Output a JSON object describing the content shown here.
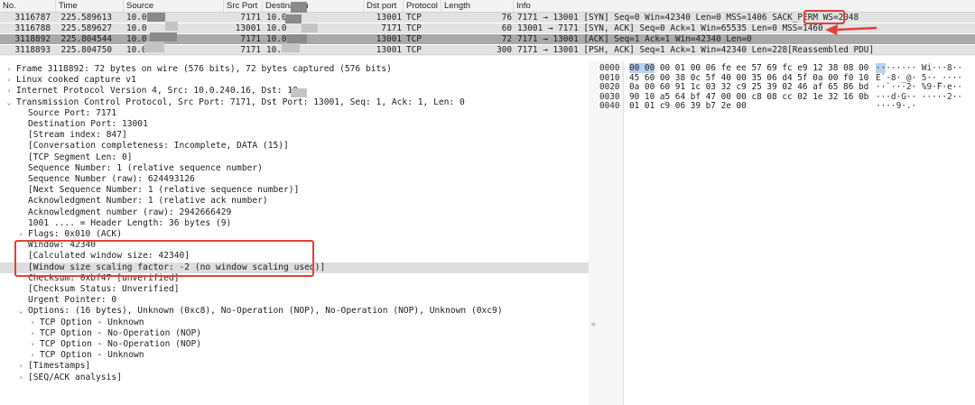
{
  "columns": {
    "no": "No.",
    "time": "Time",
    "source": "Source",
    "src_port": "Src Port",
    "destination": "Destination",
    "dst_port": "Dst port",
    "protocol": "Protocol",
    "length": "Length",
    "info": "Info"
  },
  "packets": [
    {
      "no": "3116787",
      "time": "225.589613",
      "source": "10.0",
      "src_port": "7171",
      "destination": "10.0",
      "dst_port": "13001",
      "protocol": "TCP",
      "length": "76",
      "info": "7171 → 13001 [SYN] Seq=0 Win=42340 Len=0 MSS=1406 SACK_PERM ",
      "info_highlight": "WS=2048"
    },
    {
      "no": "3116788",
      "time": "225.589627",
      "source": "10.0",
      "src_port": "13001",
      "destination": "10.0",
      "dst_port": "7171",
      "protocol": "TCP",
      "length": "60",
      "info": "13001 → 7171 [SYN, ACK] Seq=0 Ack=1 Win=65535 Len=0 MSS=1460",
      "info_highlight": ""
    },
    {
      "no": "3118892",
      "time": "225.804544",
      "source": "10.0",
      "src_port": "7171",
      "destination": "10.0",
      "dst_port": "13001",
      "protocol": "TCP",
      "length": "72",
      "info": "7171 → 13001 [ACK] Seq=1 Ack=1 Win=42340 Len=0",
      "info_highlight": ""
    },
    {
      "no": "3118893",
      "time": "225.804750",
      "source": "10.0",
      "src_port": "7171",
      "destination": "10.0",
      "dst_port": "13001",
      "protocol": "TCP",
      "length": "300",
      "info": "7171 → 13001 [PSH, ACK] Seq=1 Ack=1 Win=42340 Len=228[Reassembled PDU]",
      "info_highlight": ""
    }
  ],
  "tree": [
    {
      "indent": 0,
      "arrow": "right",
      "text": "Frame 3118892: 72 bytes on wire (576 bits), 72 bytes captured (576 bits)"
    },
    {
      "indent": 0,
      "arrow": "right",
      "text": "Linux cooked capture v1"
    },
    {
      "indent": 0,
      "arrow": "right",
      "text": "Internet Protocol Version 4, Src: 10.0.240.16, Dst: 10."
    },
    {
      "indent": 0,
      "arrow": "down",
      "text": "Transmission Control Protocol, Src Port: 7171, Dst Port: 13001, Seq: 1, Ack: 1, Len: 0"
    },
    {
      "indent": 1,
      "arrow": "",
      "text": "Source Port: 7171"
    },
    {
      "indent": 1,
      "arrow": "",
      "text": "Destination Port: 13001"
    },
    {
      "indent": 1,
      "arrow": "",
      "text": "[Stream index: 847]"
    },
    {
      "indent": 1,
      "arrow": "",
      "text": "[Conversation completeness: Incomplete, DATA (15)]"
    },
    {
      "indent": 1,
      "arrow": "",
      "text": "[TCP Segment Len: 0]"
    },
    {
      "indent": 1,
      "arrow": "",
      "text": "Sequence Number: 1    (relative sequence number)"
    },
    {
      "indent": 1,
      "arrow": "",
      "text": "Sequence Number (raw): 624493126"
    },
    {
      "indent": 1,
      "arrow": "",
      "text": "[Next Sequence Number: 1    (relative sequence number)]"
    },
    {
      "indent": 1,
      "arrow": "",
      "text": "Acknowledgment Number: 1    (relative ack number)"
    },
    {
      "indent": 1,
      "arrow": "",
      "text": "Acknowledgment number (raw): 2942666429"
    },
    {
      "indent": 1,
      "arrow": "",
      "text": "1001 .... = Header Length: 36 bytes (9)"
    },
    {
      "indent": 1,
      "arrow": "right",
      "text": "Flags: 0x010 (ACK)"
    },
    {
      "indent": 1,
      "arrow": "",
      "text": "Window: 42340"
    },
    {
      "indent": 1,
      "arrow": "",
      "text": "[Calculated window size: 42340]"
    },
    {
      "indent": 1,
      "arrow": "",
      "text": "[Window size scaling factor: -2 (no window scaling used)]"
    },
    {
      "indent": 1,
      "arrow": "",
      "text": "Checksum: 0xbf47 [unverified]"
    },
    {
      "indent": 1,
      "arrow": "",
      "text": "[Checksum Status: Unverified]"
    },
    {
      "indent": 1,
      "arrow": "",
      "text": "Urgent Pointer: 0"
    },
    {
      "indent": 1,
      "arrow": "down",
      "text": "Options: (16 bytes), Unknown (0xc8), No-Operation (NOP), No-Operation (NOP), Unknown (0xc9)"
    },
    {
      "indent": 2,
      "arrow": "right",
      "text": "TCP Option - Unknown"
    },
    {
      "indent": 2,
      "arrow": "right",
      "text": "TCP Option - No-Operation (NOP)"
    },
    {
      "indent": 2,
      "arrow": "right",
      "text": "TCP Option - No-Operation (NOP)"
    },
    {
      "indent": 2,
      "arrow": "right",
      "text": "TCP Option - Unknown"
    },
    {
      "indent": 1,
      "arrow": "right",
      "text": "[Timestamps]"
    },
    {
      "indent": 1,
      "arrow": "right",
      "text": "[SEQ/ACK analysis]"
    }
  ],
  "bytes": [
    {
      "offset": "0000",
      "hex_hl": "00 00",
      "hex": " 00 01 00 06 fe ee  57 69 fc e9 12 38 08 00",
      "ascii_hl": "··",
      "ascii": "······ Wi···8··"
    },
    {
      "offset": "0010",
      "hex_hl": "",
      "hex": "45 60 00 38 0c 5f 40 00  35 06 d4 5f 0a 00 f0 10",
      "ascii_hl": "",
      "ascii": "E`·8·_@· 5··_····"
    },
    {
      "offset": "0020",
      "hex_hl": "",
      "hex": "0a 00 60 91 1c 03 32 c9  25 39 02 46 af 65 86 bd",
      "ascii_hl": "",
      "ascii": "··`···2· %9·F·e··"
    },
    {
      "offset": "0030",
      "hex_hl": "",
      "hex": "90 10 a5 64 bf 47 00 00  c8 08 cc 02 1e 32 16 0b",
      "ascii_hl": "",
      "ascii": "···d·G·· ·····2··"
    },
    {
      "offset": "0040",
      "hex_hl": "",
      "hex": "01 01 c9 06 39 b7 2e 00",
      "ascii_hl": "",
      "ascii": "····9·.·"
    }
  ],
  "colors": {
    "annotation": "#e2403a",
    "selected_row": "#a9a9a9",
    "byte_highlight": "#b6d3f0"
  }
}
